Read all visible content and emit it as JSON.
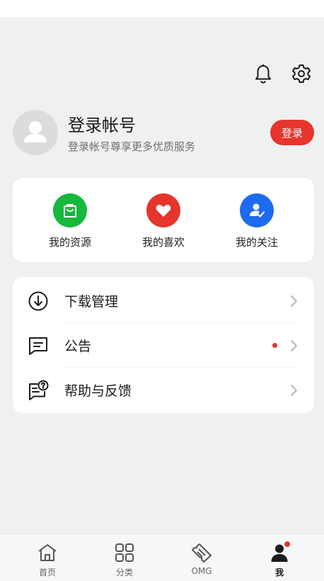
{
  "header": {
    "notification_icon": "bell-icon",
    "settings_icon": "gear-icon"
  },
  "profile": {
    "title": "登录帐号",
    "subtitle": "登录帐号尊享更多优质服务",
    "login_label": "登录",
    "avatar_icon": "user-avatar-icon"
  },
  "quick_actions": [
    {
      "label": "我的资源",
      "icon": "shopping-bag-icon",
      "color": "#16b93b"
    },
    {
      "label": "我的喜欢",
      "icon": "heart-icon",
      "color": "#e5352c"
    },
    {
      "label": "我的关注",
      "icon": "user-check-icon",
      "color": "#1e6bf0"
    }
  ],
  "menu": [
    {
      "label": "下载管理",
      "icon": "download-icon",
      "has_dot": false
    },
    {
      "label": "公告",
      "icon": "message-icon",
      "has_dot": true
    },
    {
      "label": "帮助与反馈",
      "icon": "help-chat-icon",
      "has_dot": false
    }
  ],
  "tabs": [
    {
      "label": "首页",
      "icon": "home-icon",
      "active": false
    },
    {
      "label": "分类",
      "icon": "grid-icon",
      "active": false
    },
    {
      "label": "OMG",
      "icon": "ticket-icon",
      "active": false
    },
    {
      "label": "我",
      "icon": "person-icon",
      "active": true,
      "badge": true
    }
  ],
  "colors": {
    "accent": "#e5352c",
    "background": "#eff0f2"
  }
}
